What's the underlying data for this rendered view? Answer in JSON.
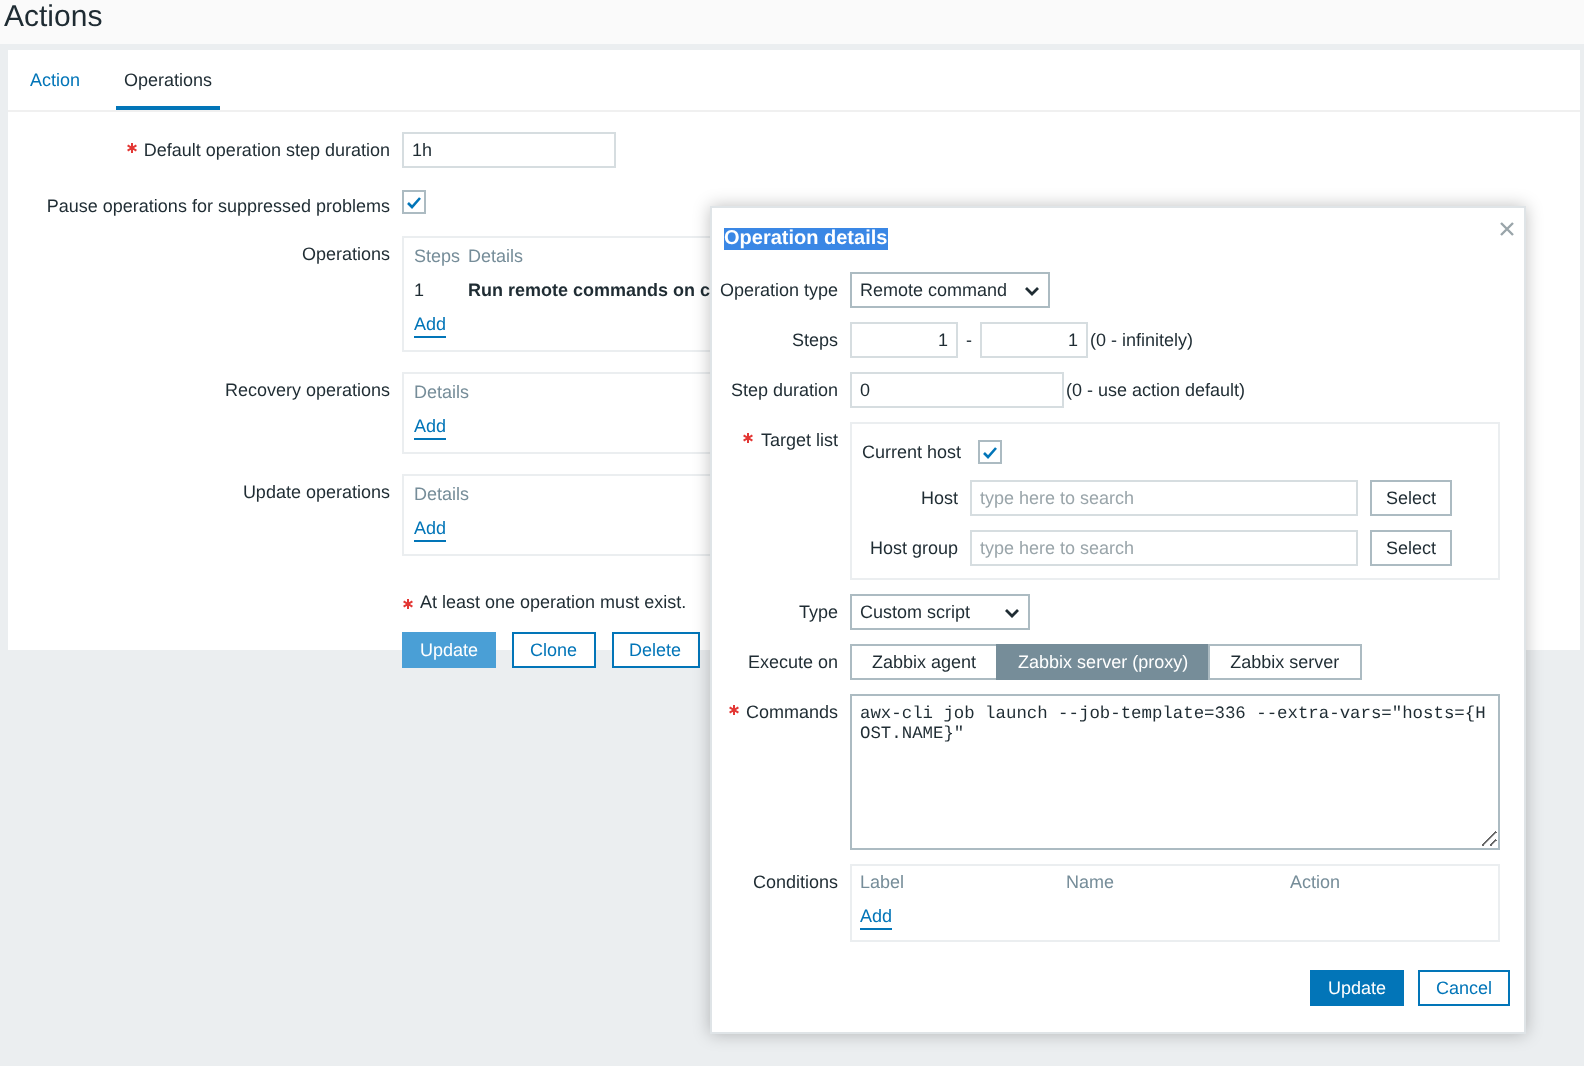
{
  "page_title": "Actions",
  "tabs": [
    {
      "label": "Action",
      "selected": false
    },
    {
      "label": "Operations",
      "selected": true
    }
  ],
  "form": {
    "fields": [
      {
        "kind": "input",
        "label": "Default operation step duration",
        "required": true,
        "value": "1h"
      },
      {
        "kind": "checkbox",
        "label": "Pause operations for suppressed problems",
        "checked": true
      },
      {
        "kind": "list",
        "label": "Operations",
        "columns": [
          "Steps",
          "Details"
        ],
        "rows": [
          {
            "cells": [
              "1",
              "Run remote commands on c"
            ]
          }
        ],
        "link": "Add"
      },
      {
        "kind": "list",
        "label": "Recovery operations",
        "columns": [
          "Details"
        ],
        "link": "Add"
      },
      {
        "kind": "list",
        "label": "Update operations",
        "columns": [
          "Details"
        ],
        "link": "Add"
      }
    ],
    "note": {
      "text": "At least one operation must exist.",
      "required": true
    },
    "buttons": [
      {
        "label": "Update",
        "primary": true
      },
      {
        "label": "Clone",
        "primary": false
      },
      {
        "label": "Delete",
        "primary": false
      }
    ]
  },
  "dialog": {
    "title": {
      "text": "Operation details",
      "highlighted": true
    },
    "fields": [
      {
        "kind": "select",
        "label": "Operation type",
        "value": "Remote command"
      },
      {
        "kind": "range",
        "label": "Steps",
        "from": "1",
        "separator": "-",
        "to": "1",
        "hint": "(0 - infinitely)"
      },
      {
        "kind": "input",
        "label": "Step duration",
        "value": "0",
        "hint": "(0 - use action default)"
      },
      {
        "kind": "group",
        "label": "Target list",
        "required": true,
        "items": [
          {
            "kind": "checkbox",
            "label": "Current host",
            "checked": true
          },
          {
            "kind": "picker",
            "label": "Host",
            "placeholder": "type here to search",
            "button": "Select"
          },
          {
            "kind": "picker",
            "label": "Host group",
            "placeholder": "type here to search",
            "button": "Select"
          }
        ]
      },
      {
        "kind": "select",
        "label": "Type",
        "value": "Custom script"
      },
      {
        "kind": "segmented",
        "label": "Execute on",
        "options": [
          {
            "label": "Zabbix agent",
            "selected": false
          },
          {
            "label": "Zabbix server (proxy)",
            "selected": true
          },
          {
            "label": "Zabbix server",
            "selected": false
          }
        ]
      },
      {
        "kind": "textarea",
        "label": "Commands",
        "required": true,
        "value": "awx-cli job launch --job-template=336 --extra-vars=\"hosts={HOST.NAME}\""
      },
      {
        "kind": "list",
        "label": "Conditions",
        "columns": [
          "Label",
          "Name",
          "Action"
        ],
        "link": "Add"
      }
    ],
    "buttons": [
      {
        "label": "Update",
        "primary": true
      },
      {
        "label": "Cancel",
        "primary": false
      }
    ]
  }
}
